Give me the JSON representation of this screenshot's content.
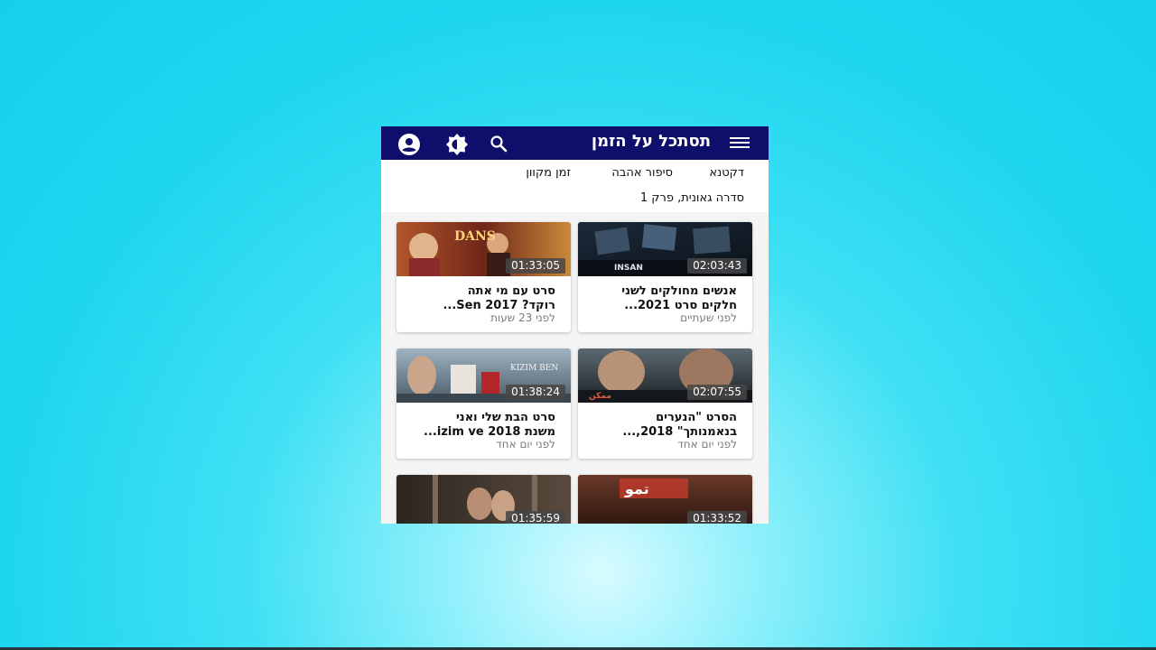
{
  "app": {
    "title": "תסתכל על הזמן"
  },
  "icons": {
    "menu": "hamburger-menu-icon",
    "search": "search-icon",
    "brightness": "brightness-icon",
    "account": "account-icon"
  },
  "colors": {
    "topbar": "#0e0f6a",
    "background": "#1fd6ef"
  },
  "categories": [
    {
      "label": "דקטנא"
    },
    {
      "label": "סיפור אהבה"
    },
    {
      "label": "זמן מקוון"
    },
    {
      "label": "סדרה גאונית, פרק 1"
    }
  ],
  "videos": [
    {
      "duration": "02:03:43",
      "title_line1": "אנשים מחולקים לשני",
      "title_line2": "חלקים סרט 2021...",
      "time": "לפני שעתיים"
    },
    {
      "duration": "01:33:05",
      "title_line1": "סרט עם מי אתה",
      "title_line2": "רוקד? Sen 2017...",
      "time": "לפני 23 שעות"
    },
    {
      "duration": "02:07:55",
      "title_line1": "הסרט \"הנערים",
      "title_line2": "בנאמנותך\" 2018,...",
      "time": "לפני יום אחד"
    },
    {
      "duration": "01:38:24",
      "title_line1": "סרט הבת שלי ואני",
      "title_line2": "משנת 2018 izim ve...",
      "time": "לפני יום אחד"
    },
    {
      "duration": "01:33:52",
      "title_line1": "",
      "title_line2": "",
      "time": ""
    },
    {
      "duration": "01:35:59",
      "title_line1": "",
      "title_line2": "",
      "time": ""
    }
  ]
}
